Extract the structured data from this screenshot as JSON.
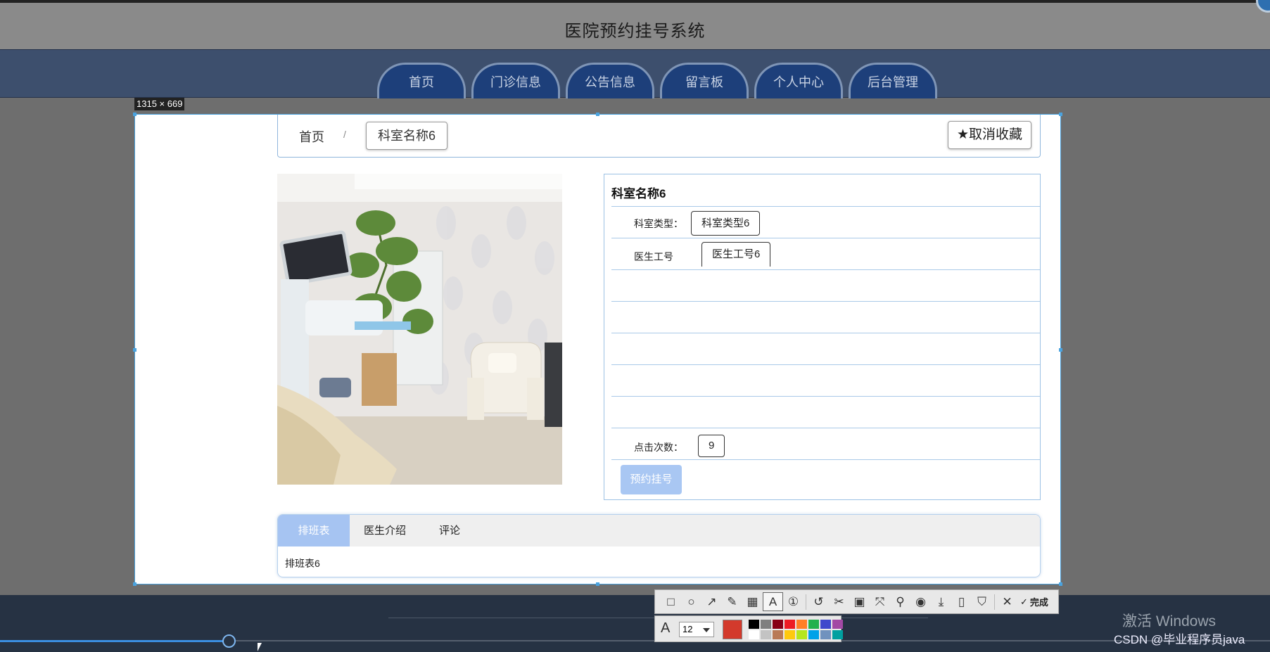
{
  "site": {
    "title": "医院预约挂号系统"
  },
  "nav": {
    "items": [
      "首页",
      "门诊信息",
      "公告信息",
      "留言板",
      "个人中心",
      "后台管理"
    ]
  },
  "screenshot_tool": {
    "size_label": "1315 × 669",
    "tools": [
      "rectangle-icon",
      "ellipse-icon",
      "arrow-icon",
      "pen-icon",
      "mosaic-icon",
      "text-icon",
      "number-icon",
      "undo-icon",
      "cutout-icon",
      "ocr-icon",
      "long-capture-icon",
      "pin-icon",
      "record-icon",
      "download-icon",
      "phone-icon",
      "bookmark-icon",
      "close-icon"
    ],
    "done_label": "完成",
    "font_size": "12",
    "selected_color": "#d33a2c",
    "palette": [
      "#000000",
      "#7f7f7f",
      "#880015",
      "#ed1c24",
      "#ff7f27",
      "#22b14c",
      "#3f48cc",
      "#a349a4",
      "#ffffff",
      "#c3c3c3",
      "#b97a57",
      "#ffc90e",
      "#b5e61d",
      "#00a2e8",
      "#7092be",
      "#00a0a0"
    ]
  },
  "breadcrumb": {
    "home": "首页",
    "separator": "/",
    "current": "科室名称6"
  },
  "favorite_button": {
    "icon": "★",
    "label": "取消收藏"
  },
  "detail": {
    "title": "科室名称6",
    "type_label": "科室类型：",
    "type_value": "科室类型6",
    "doctor_label": "医生工号",
    "doctor_value": "医生工号6",
    "clicks_label": "点击次数：",
    "clicks_value": "9",
    "book_button": "预约挂号"
  },
  "tabs": {
    "items": [
      "排班表",
      "医生介绍",
      "评论"
    ],
    "active": 0,
    "content": "排班表6"
  },
  "overlay": {
    "watermark": "激活 Windows",
    "csdn": "CSDN @毕业程序员java"
  },
  "player": {
    "progress": 0.18
  }
}
